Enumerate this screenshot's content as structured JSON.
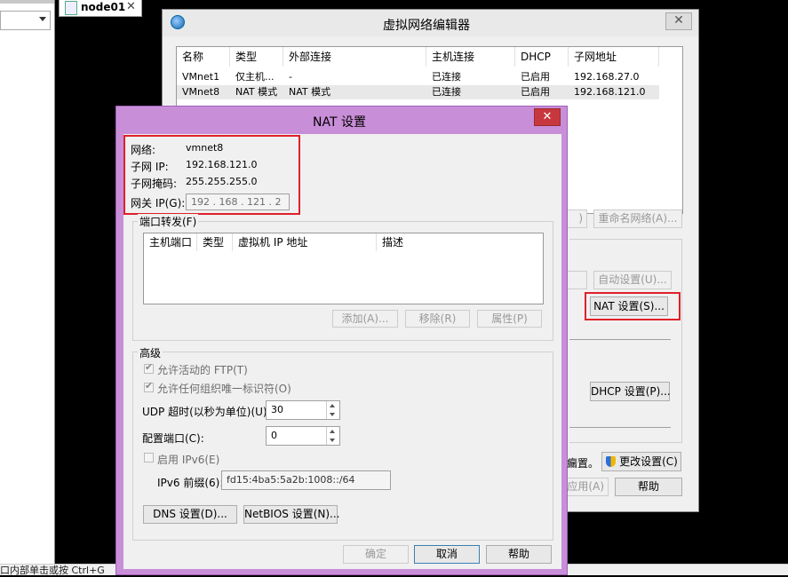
{
  "host": {
    "tab_label": "node01",
    "tab_close": "✕",
    "status_text": "口内部单击或按 Ctrl+G"
  },
  "vne": {
    "title": "虚拟网络编辑器",
    "close": "✕",
    "columns": [
      "名称",
      "类型",
      "外部连接",
      "主机连接",
      "DHCP",
      "子网地址"
    ],
    "rows": [
      [
        "VMnet1",
        "仅主机...",
        "-",
        "已连接",
        "已启用",
        "192.168.27.0"
      ],
      [
        "VMnet8",
        "NAT 模式",
        "NAT 模式",
        "已连接",
        "已启用",
        "192.168.121.0"
      ]
    ],
    "partial_btn": ")",
    "rename_btn": "重命名网络(A)...",
    "auto_btn": "自动设置(U)...",
    "nat_btn": "NAT 设置(S)...",
    "dhcp_btn": "DHCP 设置(P)...",
    "partial_text": "瘺置。",
    "change_btn": "更改设置(C)",
    "apply_btn": "应用(A)",
    "apply_partial": "应用(A)",
    "help_btn": "帮助"
  },
  "nat": {
    "title": "NAT 设置",
    "close": "✕",
    "network_label": "网络:",
    "network_value": "vmnet8",
    "subnet_ip_label": "子网 IP:",
    "subnet_ip_value": "192.168.121.0",
    "mask_label": "子网掩码:",
    "mask_value": "255.255.255.0",
    "gateway_label": "网关 IP(G):",
    "gateway_value": "192 . 168 . 121 . 2",
    "port_forward_label": "端口转发(F)",
    "pf_columns": [
      "主机端口",
      "类型",
      "虚拟机 IP 地址",
      "描述"
    ],
    "add_btn": "添加(A)...",
    "remove_btn": "移除(R)",
    "props_btn": "属性(P)",
    "advanced_label": "高级",
    "allow_ftp": "允许活动的 FTP(T)",
    "allow_oui": "允许任何组织唯一标识符(O)",
    "udp_label": "UDP 超时(以秒为单位)(U):",
    "udp_value": "30",
    "config_port_label": "配置端口(C):",
    "config_port_value": "0",
    "ipv6_label": "启用 IPv6(E)",
    "ipv6_prefix_label": "IPv6 前缀(6):",
    "ipv6_prefix_value": "fd15:4ba5:5a2b:1008::/64",
    "dns_btn": "DNS 设置(D)...",
    "netbios_btn": "NetBIOS 设置(N)...",
    "ok_btn": "确定",
    "cancel_btn": "取消",
    "help_btn": "帮助"
  },
  "colors": {
    "highlight": "#e0202a",
    "nat_frame": "#c98ed8",
    "close_red": "#c7383e"
  }
}
